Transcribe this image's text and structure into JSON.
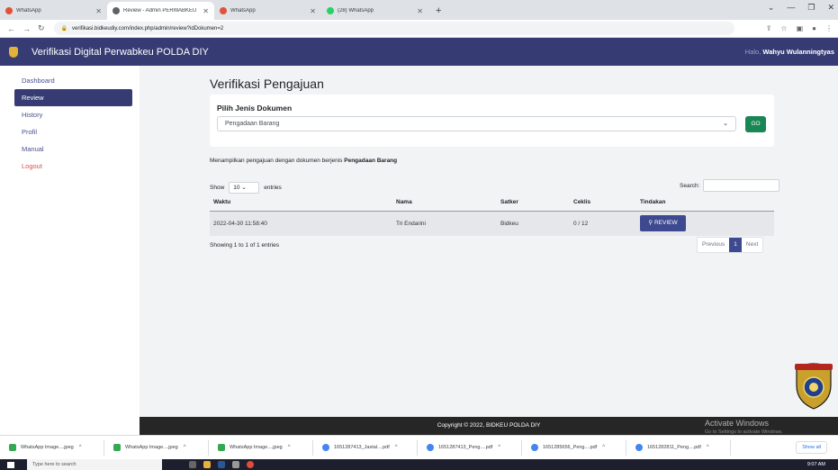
{
  "browser": {
    "tabs": [
      {
        "title": "WhatsApp",
        "icon": "whatsapp-alert-icon",
        "active": false
      },
      {
        "title": "Review - Admin PERWABKEU",
        "icon": "globe-icon",
        "active": true
      },
      {
        "title": "WhatsApp",
        "icon": "whatsapp-alert-icon",
        "active": false
      },
      {
        "title": "(28) WhatsApp",
        "icon": "whatsapp-icon",
        "active": false
      }
    ],
    "url": "verifikasi.bidkeudiy.com/index.php/admin/review?idDokumen=2"
  },
  "navbar": {
    "brand": "Verifikasi Digital Perwabkeu POLDA DIY",
    "greeting_prefix": "Halo,",
    "user_name": "Wahyu Wulanningtyas"
  },
  "sidebar": {
    "items": [
      {
        "label": "Dashboard"
      },
      {
        "label": "Review"
      },
      {
        "label": "History"
      },
      {
        "label": "Profil"
      },
      {
        "label": "Manual"
      },
      {
        "label": "Logout"
      }
    ],
    "active_item": "Review"
  },
  "main": {
    "page_title": "Verifikasi Pengajuan",
    "doc_type_label": "Pilih Jenis Dokumen",
    "doc_type_value": "Pengadaan Barang",
    "go_label": "GO",
    "info_prefix": "Menampilkan pengajuan dengan dokumen berjenis",
    "info_doc_type": "Pengadaan Barang",
    "show_label": "Show",
    "entries_count": "10",
    "entries_label": "entries",
    "search_label": "Search:",
    "table": {
      "headers": [
        "Waktu",
        "Nama",
        "Satker",
        "Ceklis",
        "Tindakan"
      ],
      "rows": [
        {
          "waktu": "2022-04-30 11:58:40",
          "nama": "Tri Endarini",
          "satker": "Bidkeu",
          "ceklis": "0 / 12",
          "action": "REVIEW"
        }
      ]
    },
    "showing_text": "Showing 1 to 1 of 1 entries",
    "pagination": {
      "prev": "Previous",
      "current": "1",
      "next": "Next"
    }
  },
  "footer": {
    "copyright": "Copyright © 2022, BIDKEU POLDA DIY",
    "activate_title": "Activate Windows",
    "activate_sub": "Go to Settings to activate Windows."
  },
  "downloads": {
    "items": [
      {
        "name": "WhatsApp Image....jpeg"
      },
      {
        "name": "WhatsApp Image....jpeg"
      },
      {
        "name": "WhatsApp Image....jpeg"
      },
      {
        "name": "1651287413_Jastal....pdf"
      },
      {
        "name": "1651287413_Peng....pdf"
      },
      {
        "name": "1651285656_Peng....pdf"
      },
      {
        "name": "1651282811_Peng....pdf"
      }
    ],
    "show_all": "Show all"
  },
  "taskbar": {
    "search_placeholder": "Type here to search",
    "time": "9:07 AM"
  },
  "colors": {
    "navbar": "#363c73",
    "accent": "#3e4a8f",
    "go_button": "#198754",
    "main_bg": "#f2f3f5",
    "footer": "#262626"
  }
}
